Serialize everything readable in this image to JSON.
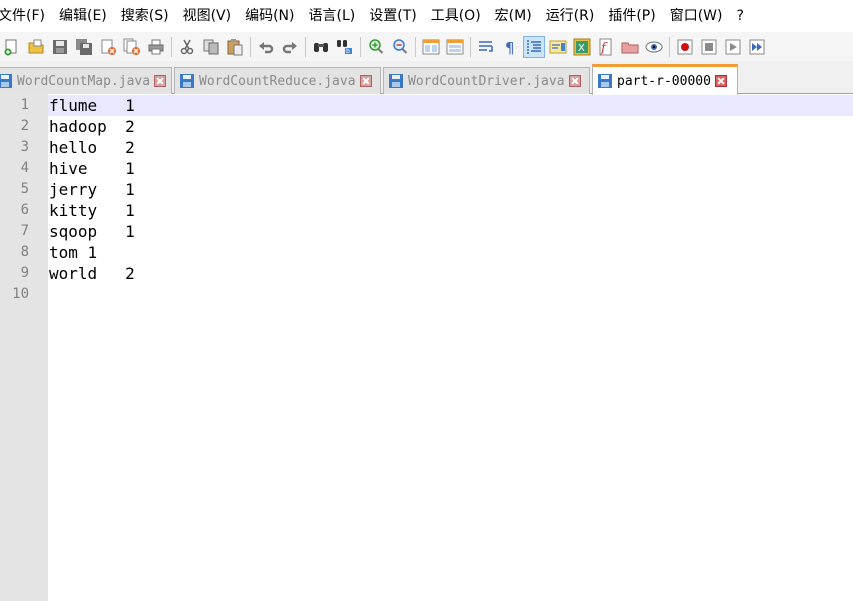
{
  "menu": [
    "文件(F)",
    "编辑(E)",
    "搜索(S)",
    "视图(V)",
    "编码(N)",
    "语言(L)",
    "设置(T)",
    "工具(O)",
    "宏(M)",
    "运行(R)",
    "插件(P)",
    "窗口(W)",
    "?"
  ],
  "toolbar_icons": [
    "new-file-icon",
    "open-file-icon",
    "save-icon",
    "save-all-icon",
    "close-icon",
    "close-all-icon",
    "print-icon",
    "cut-icon",
    "copy-icon",
    "paste-icon",
    "undo-icon",
    "redo-icon",
    "find-icon",
    "replace-icon",
    "zoom-in-icon",
    "zoom-out-icon",
    "sync-vertical-icon",
    "sync-horizontal-icon",
    "word-wrap-icon",
    "show-all-chars-icon",
    "indent-guide-icon",
    "document-map-icon",
    "function-list-icon",
    "folder-workspace-icon",
    "doc-switcher-icon",
    "monitoring-icon",
    "record-macro-icon",
    "stop-macro-icon",
    "play-macro-icon",
    "run-macro-multiple-icon"
  ],
  "tabs": [
    {
      "label": "WordCountMap.java",
      "active": false
    },
    {
      "label": "WordCountReduce.java",
      "active": false
    },
    {
      "label": "WordCountDriver.java",
      "active": false
    },
    {
      "label": "part-r-00000",
      "active": true
    }
  ],
  "editor": {
    "line_numbers": [
      "1",
      "2",
      "3",
      "4",
      "5",
      "6",
      "7",
      "8",
      "9",
      "10"
    ],
    "lines": [
      "flume\t1",
      "hadoop\t2",
      "hello\t2",
      "hive\t1",
      "jerry\t1",
      "kitty\t1",
      "sqoop\t1",
      "tom 1",
      "world\t2",
      ""
    ],
    "current_line": 1
  },
  "colors": {
    "tab_active_accent": "#f39c34",
    "current_line_bg": "#e8e8ff",
    "gutter_bg": "#e4e4e4"
  }
}
